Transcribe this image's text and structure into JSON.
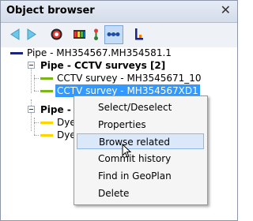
{
  "window": {
    "title": "Object browser",
    "close_icon": "close-icon"
  },
  "toolbar": {
    "buttons": [
      {
        "name": "back-arrow-icon"
      },
      {
        "name": "forward-arrow-icon"
      },
      {
        "name": "target-icon"
      },
      {
        "name": "grid-icon"
      },
      {
        "name": "link-icon"
      },
      {
        "name": "connect-icon"
      },
      {
        "name": "chart-icon"
      }
    ]
  },
  "tree": {
    "root": {
      "label": "Pipe - MH354567.MH354581.1",
      "color": "#1a237e"
    },
    "group1": {
      "label": "Pipe - CCTV surveys [2]"
    },
    "item1": {
      "label": "CCTV survey - MH3545671_10",
      "color": "#7cb518"
    },
    "item2": {
      "label": "CCTV survey - MH354567XD1",
      "color": "#7cb518"
    },
    "group2": {
      "label": "Pipe - d"
    },
    "item3": {
      "label": "Dye",
      "color": "#ffd700"
    },
    "item4": {
      "label": "Dye",
      "color": "#ffd700"
    }
  },
  "context_menu": {
    "items": [
      "Select/Deselect",
      "Properties",
      "Browse related",
      "Commit history",
      "Find in GeoPlan",
      "Delete"
    ],
    "highlighted_index": 2
  },
  "colors": {
    "selection": "#3399ff",
    "menu_highlight": "#dbe8f9"
  }
}
